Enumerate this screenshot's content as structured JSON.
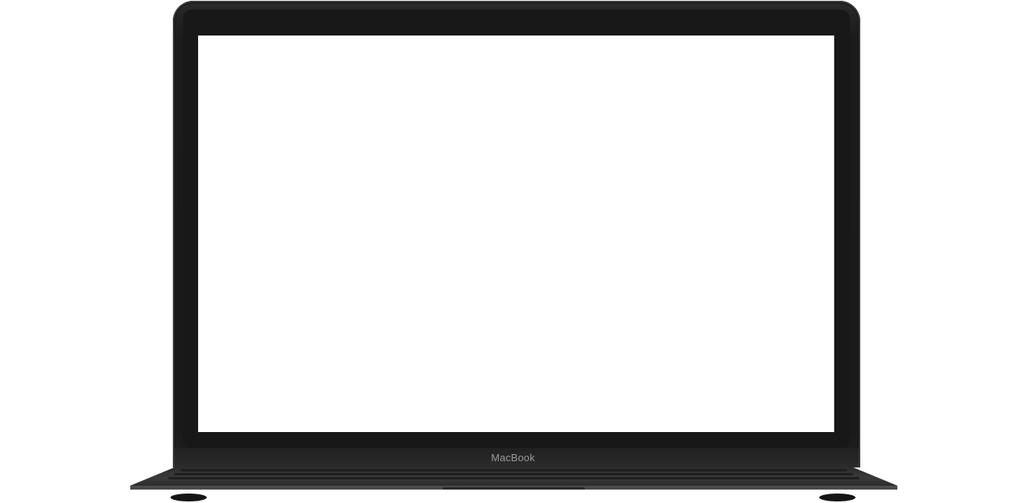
{
  "device": {
    "brand_label": "MacBook"
  },
  "colors": {
    "frame": "#1a1a1a",
    "screen": "#ffffff",
    "label": "#9a9a9a"
  }
}
